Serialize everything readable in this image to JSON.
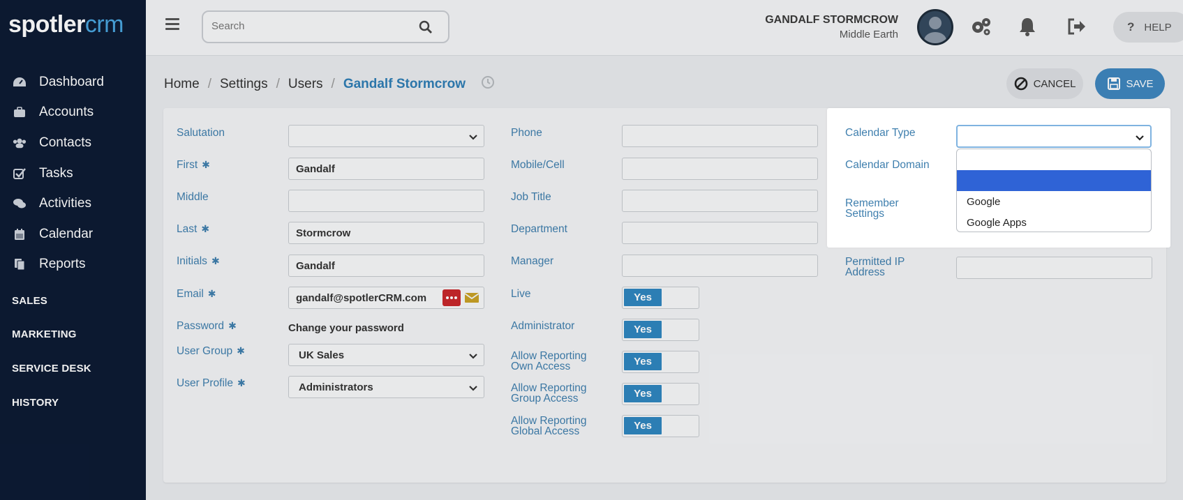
{
  "brand": {
    "logo_main": "spotler",
    "logo_accent": "crm"
  },
  "sidebar": {
    "items": [
      {
        "label": "Dashboard",
        "icon": "dashboard-icon"
      },
      {
        "label": "Accounts",
        "icon": "briefcase-icon"
      },
      {
        "label": "Contacts",
        "icon": "users-icon"
      },
      {
        "label": "Tasks",
        "icon": "checkbox-icon"
      },
      {
        "label": "Activities",
        "icon": "comments-icon"
      },
      {
        "label": "Calendar",
        "icon": "calendar-icon"
      },
      {
        "label": "Reports",
        "icon": "reports-icon"
      }
    ],
    "sections": [
      "SALES",
      "MARKETING",
      "SERVICE DESK",
      "HISTORY"
    ]
  },
  "topbar": {
    "search_placeholder": "Search",
    "user_name": "GANDALF STORMCROW",
    "user_location": "Middle Earth",
    "help_label": "HELP"
  },
  "breadcrumb": {
    "home": "Home",
    "settings": "Settings",
    "users": "Users",
    "current": "Gandalf Stormcrow"
  },
  "actions": {
    "cancel": "CANCEL",
    "save": "SAVE"
  },
  "form": {
    "col1": {
      "salutation": {
        "label": "Salutation",
        "value": ""
      },
      "first": {
        "label": "First",
        "value": "Gandalf"
      },
      "middle": {
        "label": "Middle",
        "value": ""
      },
      "last": {
        "label": "Last",
        "value": "Stormcrow"
      },
      "initials": {
        "label": "Initials",
        "value": "Gandalf"
      },
      "email": {
        "label": "Email",
        "value": "gandalf@spotlerCRM.com"
      },
      "password": {
        "label": "Password",
        "value": "Change your password"
      },
      "user_group": {
        "label": "User Group",
        "value": "UK Sales"
      },
      "user_profile": {
        "label": "User Profile",
        "value": "Administrators"
      },
      "required_mark": "✱"
    },
    "col2": {
      "phone": {
        "label": "Phone",
        "value": ""
      },
      "mobile": {
        "label": "Mobile/Cell",
        "value": ""
      },
      "job_title": {
        "label": "Job Title",
        "value": ""
      },
      "department": {
        "label": "Department",
        "value": ""
      },
      "manager": {
        "label": "Manager",
        "value": ""
      },
      "live": {
        "label": "Live",
        "value": "Yes"
      },
      "administrator": {
        "label": "Administrator",
        "value": "Yes"
      },
      "rep_own": {
        "label1": "Allow Reporting",
        "label2": "Own Access",
        "value": "Yes"
      },
      "rep_group": {
        "label1": "Allow Reporting",
        "label2": "Group Access",
        "value": "Yes"
      },
      "rep_global": {
        "label1": "Allow Reporting",
        "label2": "Global Access",
        "value": "Yes"
      }
    },
    "col3": {
      "calendar_type": {
        "label": "Calendar Type",
        "value": "",
        "options": [
          "",
          "Google",
          "Google Apps"
        ]
      },
      "calendar_domain": {
        "label": "Calendar Domain"
      },
      "remember": {
        "label1": "Remember",
        "label2": "Settings"
      },
      "permitted_ip": {
        "label1": "Permitted IP",
        "label2": "Address",
        "value": ""
      }
    }
  },
  "colors": {
    "sidebar_bg": "#0d1b34",
    "accent": "#2f86c0",
    "label": "#3f7fae",
    "selected_option": "#2f63d6"
  }
}
